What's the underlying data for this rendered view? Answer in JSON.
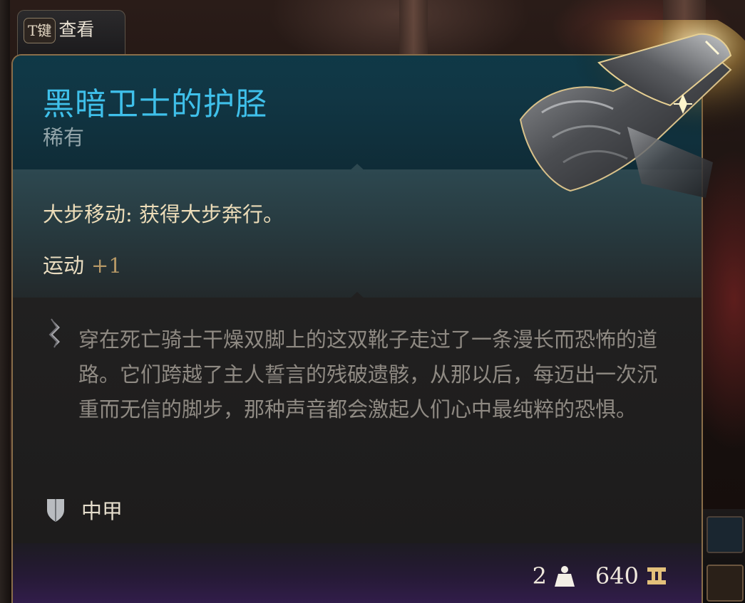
{
  "key_hint": {
    "key": "T键",
    "action": "查看"
  },
  "item": {
    "name": "黑暗卫士的护胫",
    "rarity": "稀有",
    "effect": "大步移动: 获得大步奔行。",
    "stat_name": "运动",
    "stat_value": "+1",
    "description": "穿在死亡骑士干燥双脚上的这双靴子走过了一条漫长而恐怖的道路。它们跨越了主人誓言的残破遗骸，从那以后，每迈出一次沉重而无信的脚步，那种声音都会激起人们心中最纯粹的恐惧。",
    "armor_type": "中甲",
    "weight": "2",
    "value": "640"
  },
  "icons": {
    "quote": "quote-mark-icon",
    "armor": "shield-icon",
    "weight": "weight-icon",
    "gold": "gold-coin-icon",
    "item_art": "gauntlet-art"
  },
  "colors": {
    "title": "#3fc0ea",
    "rarity": "#93a5aa",
    "effect": "#ecdcb8",
    "stat_value": "#b69866",
    "description": "#8f8a83",
    "border": "#8a6e4a",
    "footer_purple": "#321d4b"
  }
}
